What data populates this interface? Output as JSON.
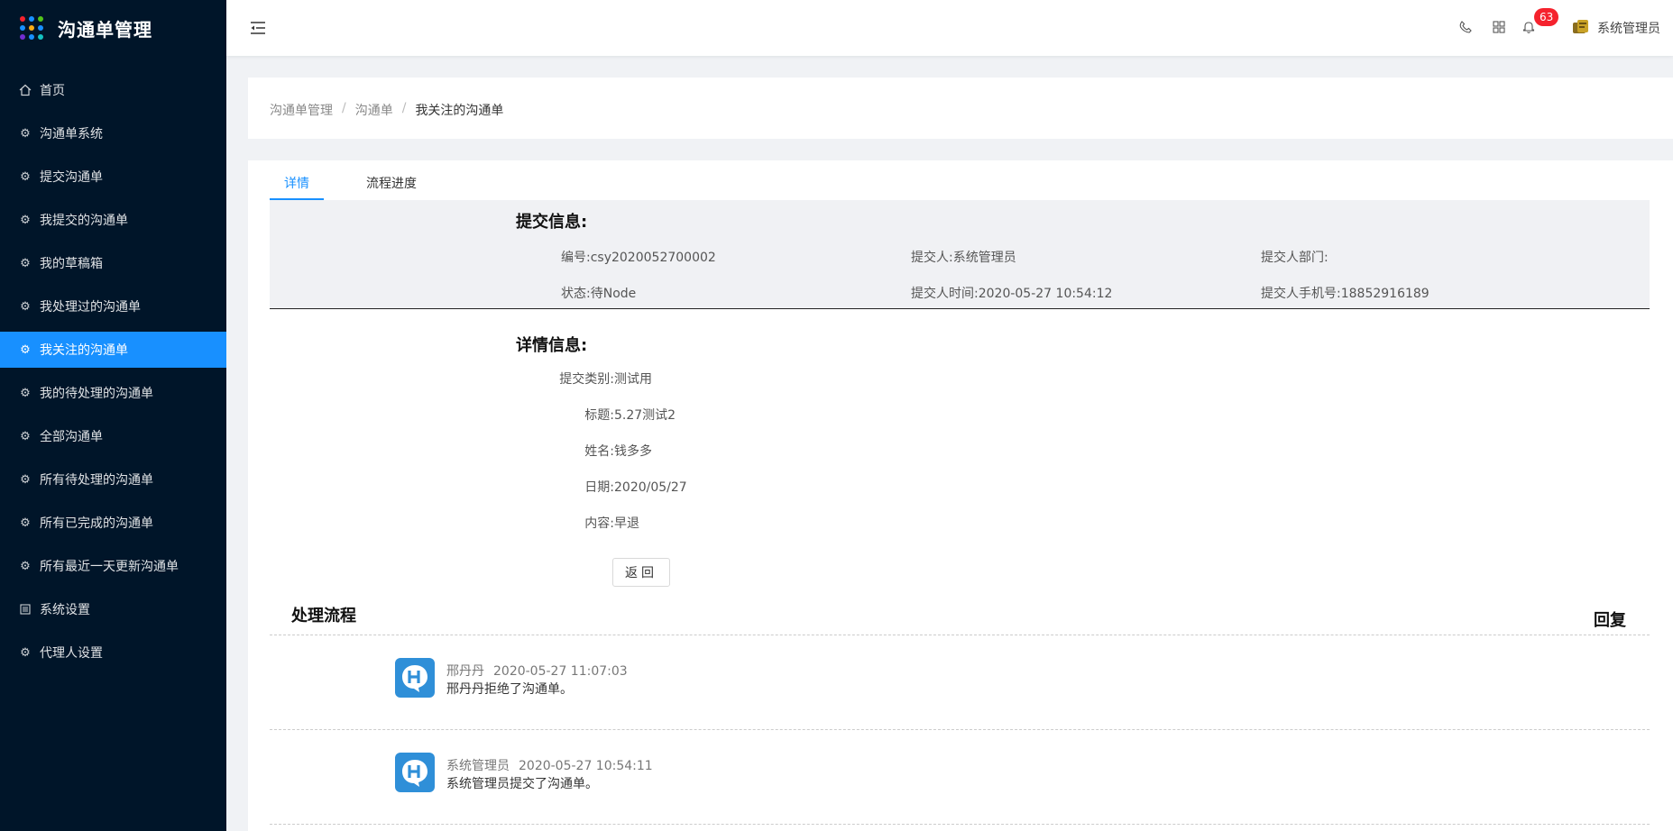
{
  "app": {
    "title": "沟通单管理",
    "logo_dot_colors": [
      "#f5222d",
      "#1890ff",
      "#52c41a",
      "#1890ff",
      "#faad14",
      "#1890ff",
      "#722ed1",
      "#1890ff",
      "#13c2c2"
    ]
  },
  "sidebar": {
    "items": [
      {
        "label": "首页",
        "icon": "home-icon",
        "active": false
      },
      {
        "label": "沟通单系统",
        "icon": "gear-icon",
        "active": false
      },
      {
        "label": "提交沟通单",
        "icon": "gear-icon",
        "active": false
      },
      {
        "label": "我提交的沟通单",
        "icon": "gear-icon",
        "active": false
      },
      {
        "label": "我的草稿箱",
        "icon": "gear-icon",
        "active": false
      },
      {
        "label": "我处理过的沟通单",
        "icon": "gear-icon",
        "active": false
      },
      {
        "label": "我关注的沟通单",
        "icon": "gear-icon",
        "active": true
      },
      {
        "label": "我的待处理的沟通单",
        "icon": "gear-icon",
        "active": false
      },
      {
        "label": "全部沟通单",
        "icon": "gear-icon",
        "active": false
      },
      {
        "label": "所有待处理的沟通单",
        "icon": "gear-icon",
        "active": false
      },
      {
        "label": "所有已完成的沟通单",
        "icon": "gear-icon",
        "active": false
      },
      {
        "label": "所有最近一天更新沟通单",
        "icon": "gear-icon",
        "active": false
      },
      {
        "label": "系统设置",
        "icon": "list-icon",
        "active": false
      },
      {
        "label": "代理人设置",
        "icon": "gear-icon",
        "active": false
      }
    ]
  },
  "header": {
    "notification_count": "63",
    "user_name": "系统管理员"
  },
  "breadcrumb": {
    "items": [
      "沟通单管理",
      "沟通单",
      "我关注的沟通单"
    ]
  },
  "tabs": {
    "detail": "详情",
    "progress": "流程进度"
  },
  "submit_info": {
    "title": "提交信息:",
    "number_label": "编号:",
    "number_value": "csy2020052700002",
    "submitter_label": "提交人:",
    "submitter_value": "系统管理员",
    "dept_label": "提交人部门:",
    "dept_value": "",
    "status_label": "状态:",
    "status_value": "待Node",
    "time_label": "提交人时间:",
    "time_value": "2020-05-27 10:54:12",
    "phone_label": "提交人手机号:",
    "phone_value": "18852916189"
  },
  "detail_info": {
    "title": "详情信息:",
    "rows": [
      {
        "label": "提交类别:",
        "value": "测试用"
      },
      {
        "label": "标题:",
        "value": "5.27测试2"
      },
      {
        "label": "姓名:",
        "value": "钱多多"
      },
      {
        "label": "日期:",
        "value": "2020/05/27"
      },
      {
        "label": "内容:",
        "value": "早退"
      }
    ]
  },
  "back_button": "返回",
  "flow": {
    "title": "处理流程",
    "reply": "回复",
    "items": [
      {
        "name": "邢丹丹",
        "time": "2020-05-27 11:07:03",
        "text": "邢丹丹拒绝了沟通单。"
      },
      {
        "name": "系统管理员",
        "time": "2020-05-27 10:54:11",
        "text": "系统管理员提交了沟通单。"
      }
    ]
  }
}
